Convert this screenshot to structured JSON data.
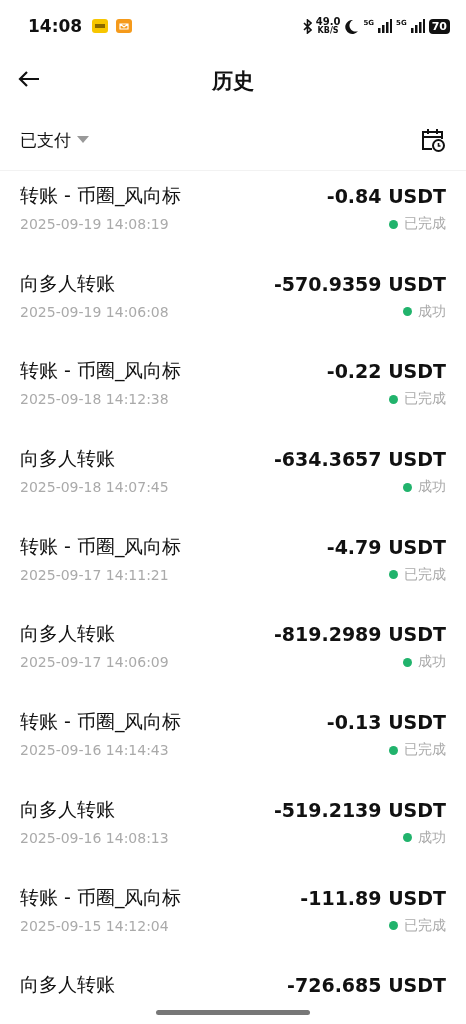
{
  "status_bar": {
    "time": "14:08",
    "net_speed": "49.0",
    "net_unit": "KB/S",
    "sim_1": "5G",
    "sim_2": "5G",
    "battery": "70"
  },
  "header": {
    "title": "历史"
  },
  "filter": {
    "label": "已支付"
  },
  "transactions": [
    {
      "title": "转账 - 币圈_风向标",
      "date": "2025-09-19 14:08:19",
      "amount": "-0.84 USDT",
      "status": "已完成"
    },
    {
      "title": "向多人转账",
      "date": "2025-09-19 14:06:08",
      "amount": "-570.9359 USDT",
      "status": "成功"
    },
    {
      "title": "转账 - 币圈_风向标",
      "date": "2025-09-18 14:12:38",
      "amount": "-0.22 USDT",
      "status": "已完成"
    },
    {
      "title": "向多人转账",
      "date": "2025-09-18 14:07:45",
      "amount": "-634.3657 USDT",
      "status": "成功"
    },
    {
      "title": "转账 - 币圈_风向标",
      "date": "2025-09-17 14:11:21",
      "amount": "-4.79 USDT",
      "status": "已完成"
    },
    {
      "title": "向多人转账",
      "date": "2025-09-17 14:06:09",
      "amount": "-819.2989 USDT",
      "status": "成功"
    },
    {
      "title": "转账 - 币圈_风向标",
      "date": "2025-09-16 14:14:43",
      "amount": "-0.13 USDT",
      "status": "已完成"
    },
    {
      "title": "向多人转账",
      "date": "2025-09-16 14:08:13",
      "amount": "-519.2139 USDT",
      "status": "成功"
    },
    {
      "title": "转账 - 币圈_风向标",
      "date": "2025-09-15 14:12:04",
      "amount": "-111.89 USDT",
      "status": "已完成"
    },
    {
      "title": "向多人转账",
      "amount": "-726.685 USDT"
    }
  ]
}
